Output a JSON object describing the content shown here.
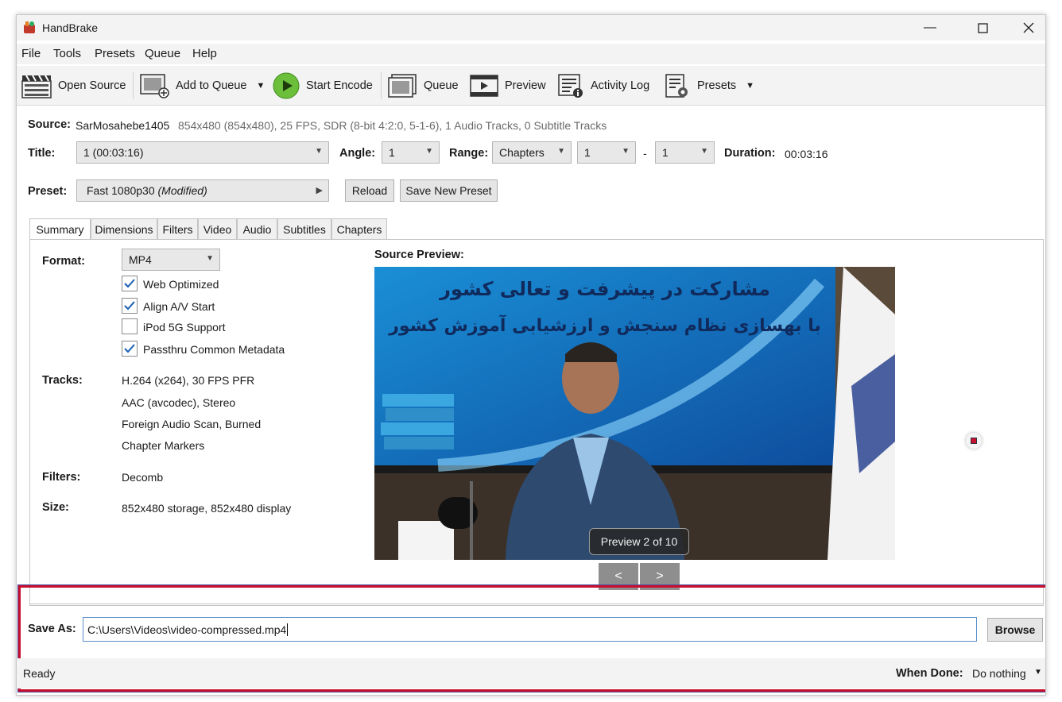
{
  "window": {
    "title": "HandBrake"
  },
  "menu": [
    "File",
    "Tools",
    "Presets",
    "Queue",
    "Help"
  ],
  "toolbar": {
    "open_source": "Open Source",
    "add_to_queue": "Add to Queue",
    "start_encode": "Start Encode",
    "queue": "Queue",
    "preview": "Preview",
    "activity_log": "Activity Log",
    "presets": "Presets"
  },
  "source": {
    "label": "Source:",
    "name": "SarMosahebe1405",
    "details": "854x480 (854x480), 25 FPS, SDR (8-bit 4:2:0, 5-1-6), 1 Audio Tracks, 0 Subtitle Tracks"
  },
  "title_row": {
    "title_label": "Title:",
    "title_value": "1  (00:03:16)",
    "angle_label": "Angle:",
    "angle_value": "1",
    "range_label": "Range:",
    "range_value": "Chapters",
    "range_start": "1",
    "range_dash": "-",
    "range_end": "1",
    "duration_label": "Duration:",
    "duration_value": "00:03:16"
  },
  "preset_row": {
    "label": "Preset:",
    "value": "Fast 1080p30",
    "modified": "(Modified)",
    "reload": "Reload",
    "save_new": "Save New Preset"
  },
  "tabs": [
    "Summary",
    "Dimensions",
    "Filters",
    "Video",
    "Audio",
    "Subtitles",
    "Chapters"
  ],
  "summary": {
    "format_label": "Format:",
    "format_value": "MP4",
    "checkboxes": [
      {
        "label": "Web Optimized",
        "checked": true
      },
      {
        "label": "Align A/V Start",
        "checked": true
      },
      {
        "label": "iPod 5G Support",
        "checked": false
      },
      {
        "label": "Passthru Common Metadata",
        "checked": true
      }
    ],
    "tracks_label": "Tracks:",
    "tracks": [
      "H.264 (x264), 30 FPS PFR",
      "AAC (avcodec), Stereo",
      "Foreign Audio Scan, Burned",
      "Chapter Markers"
    ],
    "filters_label": "Filters:",
    "filters_value": "Decomb",
    "size_label": "Size:",
    "size_value": "852x480 storage, 852x480 display"
  },
  "preview": {
    "label": "Source Preview:",
    "banner_line1": "مشارکت در پیشرفت و تعالی کشور",
    "banner_line2": "با بهسازی نظام سنجش و ارزشیابی آموزش کشور",
    "badge": "Preview 2 of 10",
    "prev": "<",
    "next": ">"
  },
  "save_as": {
    "label": "Save As:",
    "value": "C:\\Users\\Videos\\video-compressed.mp4",
    "browse": "Browse"
  },
  "status": {
    "text": "Ready",
    "when_done_label": "When Done:",
    "when_done_value": "Do nothing"
  },
  "colors": {
    "highlight": "#c8102e",
    "encode_green": "#6cbf3a"
  }
}
